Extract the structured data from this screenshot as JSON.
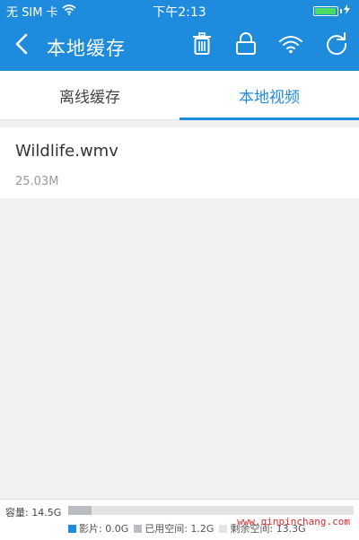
{
  "status_bar": {
    "carrier": "无 SIM 卡",
    "time": "下午2:13",
    "battery_level": 0.95
  },
  "nav": {
    "title": "本地缓存",
    "icons": [
      "back-icon",
      "trash-icon",
      "lock-icon",
      "wifi-icon",
      "refresh-icon"
    ]
  },
  "tabs": [
    {
      "label": "离线缓存",
      "active": false
    },
    {
      "label": "本地视频",
      "active": true
    }
  ],
  "files": [
    {
      "name": "Wildlife.wmv",
      "size": "25.03M"
    }
  ],
  "storage": {
    "capacity_label": "容量: 14.5G",
    "used_fraction": 0.083,
    "legend": {
      "movies": "影片: 0.0G",
      "used": "已用空间: 1.2G",
      "free": "剩余空间: 13.3G"
    }
  },
  "watermark": "www.qinpinchang.com",
  "colors": {
    "brand": "#1f8bdc",
    "movies": "#1f8bdc",
    "used": "#b9bcc0",
    "free": "#e4e4e4",
    "watermark": "#e12a2a"
  }
}
